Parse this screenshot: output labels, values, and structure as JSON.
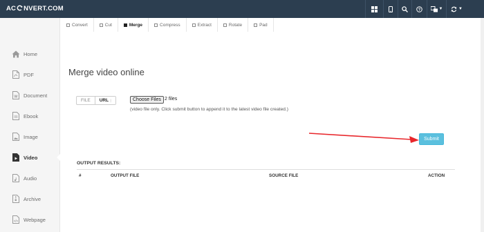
{
  "header": {
    "logo_left": "AC",
    "logo_right": "NVERT.COM"
  },
  "sidebar": {
    "items": [
      {
        "label": "Home",
        "icon": "home-icon"
      },
      {
        "label": "PDF",
        "icon": "pdf-icon"
      },
      {
        "label": "Document",
        "icon": "document-icon"
      },
      {
        "label": "Ebook",
        "icon": "ebook-icon"
      },
      {
        "label": "Image",
        "icon": "image-icon"
      },
      {
        "label": "Video",
        "icon": "video-icon",
        "active": true
      },
      {
        "label": "Audio",
        "icon": "audio-icon"
      },
      {
        "label": "Archive",
        "icon": "archive-icon"
      },
      {
        "label": "Webpage",
        "icon": "webpage-icon"
      }
    ]
  },
  "tabs": [
    {
      "label": "Convert"
    },
    {
      "label": "Cut"
    },
    {
      "label": "Merge",
      "active": true
    },
    {
      "label": "Compress"
    },
    {
      "label": "Extract"
    },
    {
      "label": "Rotate"
    },
    {
      "label": "Pad"
    }
  ],
  "main": {
    "title": "Merge video online",
    "source_toggle": {
      "file": "FILE",
      "url": "URL"
    },
    "choose_files_label": "Choose Files",
    "files_selected": "2 files",
    "hint": "(video file only. Click submit button to append it to the latest video file created.)",
    "submit_label": "Submit",
    "output_title": "OUTPUT RESULTS:",
    "columns": [
      "#",
      "OUTPUT FILE",
      "SOURCE FILE",
      "ACTION"
    ]
  },
  "colors": {
    "topbar": "#2c3e50",
    "submit": "#5bc0de",
    "arrow": "#e8262b"
  }
}
